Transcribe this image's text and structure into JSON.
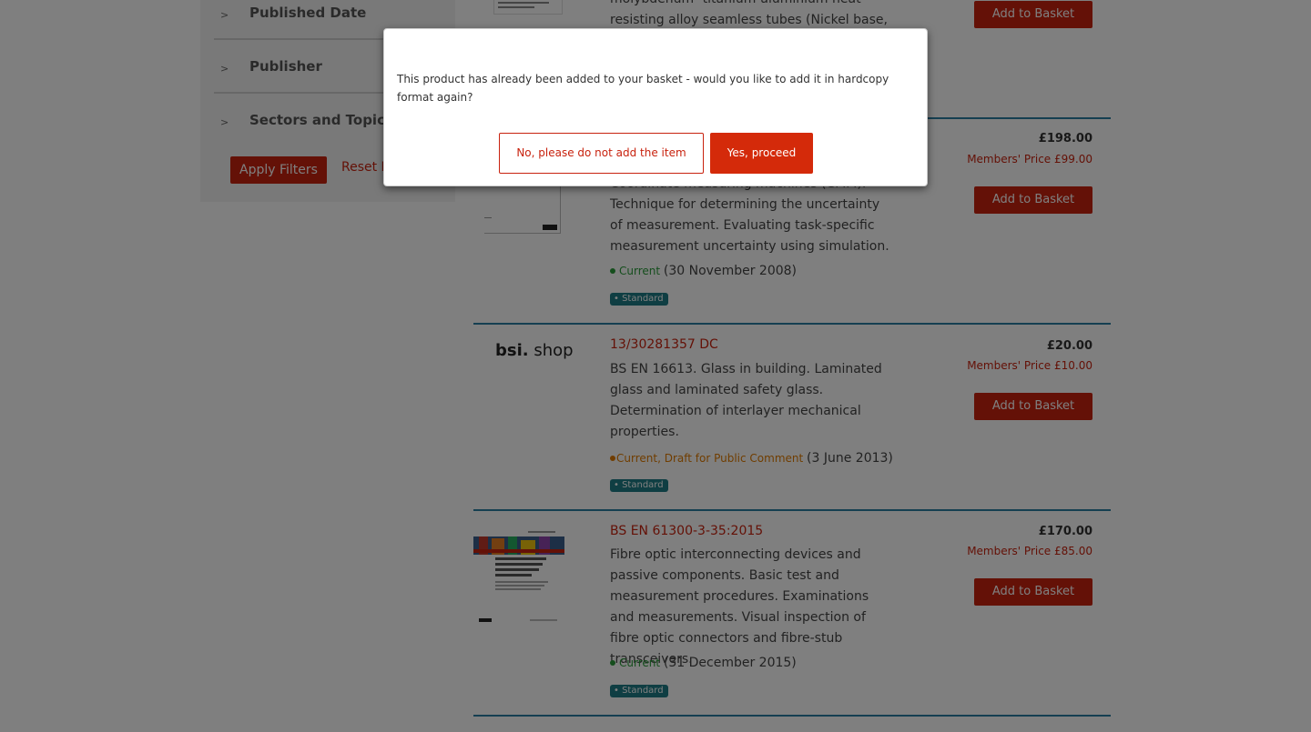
{
  "sidebar": {
    "filters": [
      {
        "label": "Published Date"
      },
      {
        "label": "Publisher"
      },
      {
        "label": "Sectors and Topics"
      }
    ],
    "apply_label": "Apply Filters",
    "reset_label": "Reset Filters"
  },
  "products": [
    {
      "description_partial": "molybdenum- titanium-aluminium heat-resisting alloy seamless tubes (Nickel base, Co",
      "basket_label": "Add to Basket"
    },
    {
      "title": "",
      "description": "Coordinate measuring machines (CMM). Technique for determining the uncertainty of measurement. Evaluating task-specific measurement uncertainty using simulation.",
      "status": "Current",
      "date": "(30 November 2008)",
      "tag": "Standard",
      "price": "£198.00",
      "members_price": "Members' Price  £99.00",
      "basket_label": "Add to Basket"
    },
    {
      "title": "13/30281357 DC",
      "description": "BS EN 16613. Glass in building. Laminated glass and laminated safety glass. Determination of interlayer mechanical properties.",
      "status": "Current, Draft for Public Comment",
      "date": "(3 June 2013)",
      "tag": "Standard",
      "price": "£20.00",
      "members_price": "Members' Price  £10.00",
      "basket_label": "Add to Basket"
    },
    {
      "title": "BS EN 61300-3-35:2015",
      "description": "Fibre optic interconnecting devices and passive components. Basic test and measurement procedures. Examinations and measurements. Visual inspection of fibre optic connectors and fibre-stub transceivers.",
      "status": "Current",
      "date": "(31 December 2015)",
      "tag": "Standard",
      "price": "£170.00",
      "members_price": "Members' Price  £85.00",
      "basket_label": "Add to Basket"
    }
  ],
  "thumbs": {
    "bsi_shop_brand": "bsi.",
    "bsi_shop_suffix": "shop",
    "bsi_mark": "bsi",
    "fibre_cover_text": "Fibre optic interconnecting devices and passive components — Basic test and measurement procedures"
  },
  "modal": {
    "message": "This product has already been added to your basket - would you like to add it in hardcopy format again?",
    "no_label": "No, please do not add the item",
    "yes_label": "Yes, proceed"
  },
  "colors": {
    "accent": "#c8220e",
    "divider": "#2b7fa3",
    "tag": "#1e7d86",
    "current": "#2a9d3a",
    "draft": "#e07b00"
  }
}
